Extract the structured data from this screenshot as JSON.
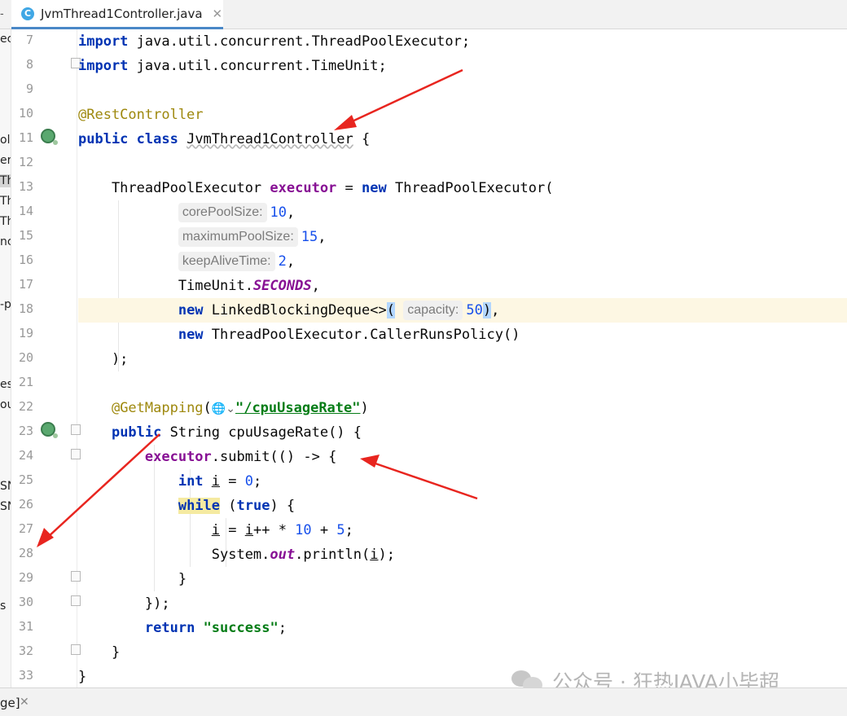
{
  "editor_tab": {
    "icon_letter": "C",
    "filename": "JvmThread1Controller.java",
    "close_glyph": "✕",
    "prev_glyph": "-",
    "active_color": "#4a88c7"
  },
  "project_panel_fragments": [
    "ec",
    "ole",
    "er",
    "Th",
    "Thr",
    "Thr",
    "nc",
    "-p",
    "es",
    "ou",
    "SN",
    "SN",
    "s"
  ],
  "gutter": {
    "line_numbers": [
      "7",
      "8",
      "9",
      "10",
      "11",
      "12",
      "13",
      "14",
      "15",
      "16",
      "17",
      "18",
      "19",
      "20",
      "21",
      "22",
      "23",
      "24",
      "25",
      "26",
      "27",
      "28",
      "29",
      "30",
      "31",
      "32",
      "33"
    ],
    "bean_icon_lines": [
      "11",
      "23"
    ],
    "fold_marker_lines": [
      "8",
      "23",
      "24",
      "29",
      "30",
      "32"
    ]
  },
  "code": {
    "current_line": "18",
    "hints": {
      "core_pool_size": "corePoolSize:",
      "maximum_pool_size": "maximumPoolSize:",
      "keep_alive_time": "keepAliveTime:",
      "capacity": "capacity:"
    },
    "colors": {
      "keyword": "#0033b3",
      "annotation": "#9e880d",
      "number": "#1750eb",
      "string": "#067d17",
      "field": "#871094",
      "current_line_bg": "#fdf7e3"
    }
  },
  "bottom_bar": {
    "label": "ge]",
    "close_glyph": "✕"
  },
  "watermark": {
    "text": "公众号 · 狂热JAVA小毕超"
  },
  "annotation_arrows": {
    "count": 3,
    "color": "#e8251f"
  }
}
